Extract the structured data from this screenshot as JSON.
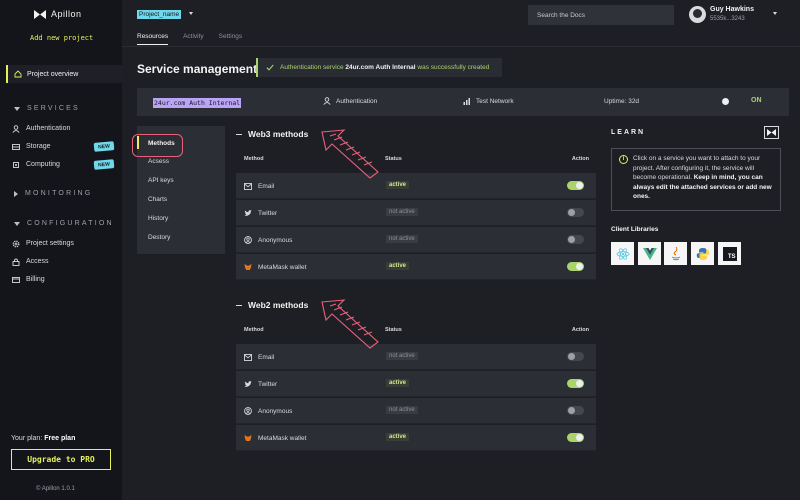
{
  "sidebar": {
    "brand": "Apillon",
    "add_project": "Add new project",
    "active_item": "Project overview",
    "sections": {
      "services": "SERVICES",
      "monitoring": "MONITORING",
      "configuration": "CONFIGURATION"
    },
    "services_items": [
      "Authentication",
      "Storage",
      "Computing"
    ],
    "new_badge": "NEW",
    "config_items": [
      "Project settings",
      "Access",
      "Billing"
    ],
    "plan_label": "Your plan:",
    "plan_value": "Free plan",
    "upgrade": "Upgrade to PRO",
    "version": "© Apillon 1.0.1"
  },
  "topbar": {
    "project_name": "Project_name",
    "tabs": [
      "Resources",
      "Activity",
      "Settings"
    ],
    "search_placeholder": "Search the Docs",
    "user_name": "Guy Hawkins",
    "user_wallet": "5535k...3243"
  },
  "page": {
    "title": "Service management",
    "toast_prefix": "Authentication service",
    "toast_service": "24ur.com Auth Internal",
    "toast_suffix": "was successfully created"
  },
  "service_bar": {
    "name": "24ur.com Auth Internal",
    "type": "Authentication",
    "network": "Test Network",
    "uptime": "Uptime: 32d",
    "status": "ON"
  },
  "side_tabs": [
    "Methods",
    "Acsess",
    "API keys",
    "Charts",
    "History",
    "Destory"
  ],
  "table_headers": {
    "method": "Method",
    "status": "Status",
    "action": "Action"
  },
  "web3": {
    "title": "Web3 methods",
    "rows": [
      {
        "name": "Email",
        "icon": "email-icon",
        "status": "active"
      },
      {
        "name": "Twitter",
        "icon": "twitter-icon",
        "status": "not active"
      },
      {
        "name": "Anonymous",
        "icon": "anonymous-icon",
        "status": "not active"
      },
      {
        "name": "MetaMask wallet",
        "icon": "metamask-icon",
        "status": "active"
      }
    ]
  },
  "web2": {
    "title": "Web2 methods",
    "rows": [
      {
        "name": "Email",
        "icon": "email-icon",
        "status": "not active"
      },
      {
        "name": "Twitter",
        "icon": "twitter-icon",
        "status": "active"
      },
      {
        "name": "Anonymous",
        "icon": "anonymous-icon",
        "status": "not active"
      },
      {
        "name": "MetaMask wallet",
        "icon": "metamask-icon",
        "status": "active"
      }
    ]
  },
  "learn": {
    "title": "LEARN",
    "text_plain": "Click on a service you want to attach to your project. After configuring it, the service will become operational.",
    "text_bold": "Keep in mind, you can always edit the attached services or add new ones.",
    "libs_title": "Client Libraries",
    "libs": [
      "react-icon",
      "vue-icon",
      "java-icon",
      "python-icon",
      "typescript-icon"
    ],
    "ts_label": "TS"
  },
  "colors": {
    "accent": "#e6f05a",
    "success": "#a9d46a",
    "highlight": "#6fd8ea",
    "annotation": "#e8607a"
  }
}
